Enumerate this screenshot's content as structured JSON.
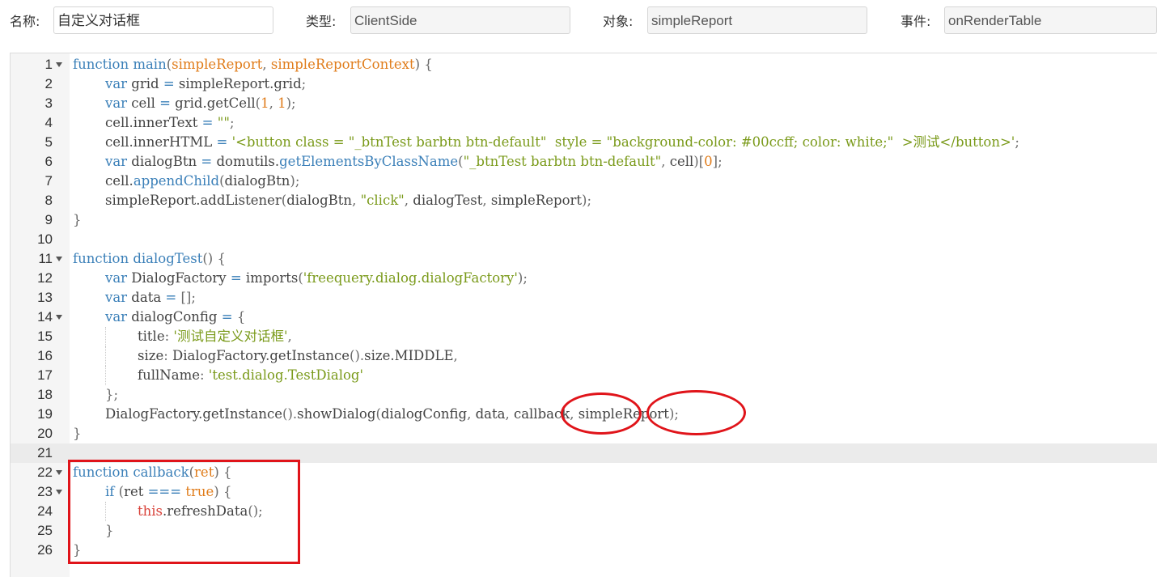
{
  "form": {
    "name_label": "名称:",
    "name_value": "自定义对话框",
    "type_label": "类型:",
    "type_value": "ClientSide",
    "object_label": "对象:",
    "object_value": "simpleReport",
    "event_label": "事件:",
    "event_value": "onRenderTable"
  },
  "editor": {
    "active_line": 21,
    "lines": [
      {
        "n": "1",
        "fold": true,
        "indent": 0,
        "tokens": [
          [
            "kw",
            "function"
          ],
          [
            "pl",
            " "
          ],
          [
            "fn",
            "main"
          ],
          [
            "pu",
            "("
          ],
          [
            "pr",
            "simpleReport"
          ],
          [
            "pu",
            ", "
          ],
          [
            "pr",
            "simpleReportContext"
          ],
          [
            "pu",
            ") {"
          ]
        ]
      },
      {
        "n": "2",
        "fold": false,
        "indent": 1,
        "tokens": [
          [
            "kw",
            "var"
          ],
          [
            "pl",
            " grid "
          ],
          [
            "op",
            "="
          ],
          [
            "pl",
            " simpleReport.grid"
          ],
          [
            "pu",
            ";"
          ]
        ]
      },
      {
        "n": "3",
        "fold": false,
        "indent": 1,
        "tokens": [
          [
            "kw",
            "var"
          ],
          [
            "pl",
            " cell "
          ],
          [
            "op",
            "="
          ],
          [
            "pl",
            " grid.getCell"
          ],
          [
            "pu",
            "("
          ],
          [
            "num",
            "1"
          ],
          [
            "pu",
            ", "
          ],
          [
            "num",
            "1"
          ],
          [
            "pu",
            ");"
          ]
        ]
      },
      {
        "n": "4",
        "fold": false,
        "indent": 1,
        "tokens": [
          [
            "pl",
            "cell.innerText "
          ],
          [
            "op",
            "="
          ],
          [
            "pl",
            " "
          ],
          [
            "str",
            "\"\""
          ],
          [
            "pu",
            ";"
          ]
        ]
      },
      {
        "n": "5",
        "fold": false,
        "indent": 1,
        "tokens": [
          [
            "pl",
            "cell.innerHTML "
          ],
          [
            "op",
            "="
          ],
          [
            "pl",
            " "
          ],
          [
            "str",
            "'<button class = \"_btnTest barbtn btn-default\"  style = \"background-color: #00ccff; color: white;\"  >测试</button>'"
          ],
          [
            "pu",
            ";"
          ]
        ]
      },
      {
        "n": "6",
        "fold": false,
        "indent": 1,
        "tokens": [
          [
            "kw",
            "var"
          ],
          [
            "pl",
            " dialogBtn "
          ],
          [
            "op",
            "="
          ],
          [
            "pl",
            " domutils."
          ],
          [
            "bt",
            "getElementsByClassName"
          ],
          [
            "pu",
            "("
          ],
          [
            "str",
            "\"_btnTest barbtn btn-default\""
          ],
          [
            "pu",
            ", "
          ],
          [
            "pl",
            "cell"
          ],
          [
            "pu",
            ")["
          ],
          [
            "num",
            "0"
          ],
          [
            "pu",
            "];"
          ]
        ]
      },
      {
        "n": "7",
        "fold": false,
        "indent": 1,
        "tokens": [
          [
            "pl",
            "cell."
          ],
          [
            "bt",
            "appendChild"
          ],
          [
            "pu",
            "("
          ],
          [
            "pl",
            "dialogBtn"
          ],
          [
            "pu",
            ");"
          ]
        ]
      },
      {
        "n": "8",
        "fold": false,
        "indent": 1,
        "tokens": [
          [
            "pl",
            "simpleReport.addListener"
          ],
          [
            "pu",
            "("
          ],
          [
            "pl",
            "dialogBtn"
          ],
          [
            "pu",
            ", "
          ],
          [
            "str",
            "\"click\""
          ],
          [
            "pu",
            ", "
          ],
          [
            "pl",
            "dialogTest"
          ],
          [
            "pu",
            ", "
          ],
          [
            "pl",
            "simpleReport"
          ],
          [
            "pu",
            ");"
          ]
        ]
      },
      {
        "n": "9",
        "fold": false,
        "indent": 0,
        "tokens": [
          [
            "pu",
            "}"
          ]
        ]
      },
      {
        "n": "10",
        "fold": false,
        "indent": 0,
        "tokens": []
      },
      {
        "n": "11",
        "fold": true,
        "indent": 0,
        "tokens": [
          [
            "kw",
            "function"
          ],
          [
            "pl",
            " "
          ],
          [
            "fn",
            "dialogTest"
          ],
          [
            "pu",
            "() {"
          ]
        ]
      },
      {
        "n": "12",
        "fold": false,
        "indent": 1,
        "tokens": [
          [
            "kw",
            "var"
          ],
          [
            "pl",
            " DialogFactory "
          ],
          [
            "op",
            "="
          ],
          [
            "pl",
            " imports"
          ],
          [
            "pu",
            "("
          ],
          [
            "str",
            "'freequery.dialog.dialogFactory'"
          ],
          [
            "pu",
            ");"
          ]
        ]
      },
      {
        "n": "13",
        "fold": false,
        "indent": 1,
        "tokens": [
          [
            "kw",
            "var"
          ],
          [
            "pl",
            " data "
          ],
          [
            "op",
            "="
          ],
          [
            "pl",
            " "
          ],
          [
            "pu",
            "[];"
          ]
        ]
      },
      {
        "n": "14",
        "fold": true,
        "indent": 1,
        "tokens": [
          [
            "kw",
            "var"
          ],
          [
            "pl",
            " dialogConfig "
          ],
          [
            "op",
            "="
          ],
          [
            "pl",
            " "
          ],
          [
            "pu",
            "{"
          ]
        ]
      },
      {
        "n": "15",
        "fold": false,
        "indent": 2,
        "tokens": [
          [
            "pl",
            "title"
          ],
          [
            "pu",
            ": "
          ],
          [
            "str",
            "'测试自定义对话框'"
          ],
          [
            "pu",
            ","
          ]
        ]
      },
      {
        "n": "16",
        "fold": false,
        "indent": 2,
        "tokens": [
          [
            "pl",
            "size"
          ],
          [
            "pu",
            ": "
          ],
          [
            "pl",
            "DialogFactory.getInstance"
          ],
          [
            "pu",
            "()."
          ],
          [
            "pl",
            "size.MIDDLE"
          ],
          [
            "pu",
            ","
          ]
        ]
      },
      {
        "n": "17",
        "fold": false,
        "indent": 2,
        "tokens": [
          [
            "pl",
            "fullName"
          ],
          [
            "pu",
            ": "
          ],
          [
            "str",
            "'test.dialog.TestDialog'"
          ]
        ]
      },
      {
        "n": "18",
        "fold": false,
        "indent": 1,
        "tokens": [
          [
            "pu",
            "};"
          ]
        ]
      },
      {
        "n": "19",
        "fold": false,
        "indent": 1,
        "tokens": [
          [
            "pl",
            "DialogFactory.getInstance"
          ],
          [
            "pu",
            "()."
          ],
          [
            "pl",
            "showDialog"
          ],
          [
            "pu",
            "("
          ],
          [
            "pl",
            "dialogConfig"
          ],
          [
            "pu",
            ", "
          ],
          [
            "pl",
            "data"
          ],
          [
            "pu",
            ", "
          ],
          [
            "pl",
            "callback"
          ],
          [
            "pu",
            ", "
          ],
          [
            "pl",
            "simpleReport"
          ],
          [
            "pu",
            ");"
          ]
        ]
      },
      {
        "n": "20",
        "fold": false,
        "indent": 0,
        "tokens": [
          [
            "pu",
            "}"
          ]
        ]
      },
      {
        "n": "21",
        "fold": false,
        "indent": 0,
        "tokens": []
      },
      {
        "n": "22",
        "fold": true,
        "indent": 0,
        "tokens": [
          [
            "kw",
            "function"
          ],
          [
            "pl",
            " "
          ],
          [
            "fn",
            "callback"
          ],
          [
            "pu",
            "("
          ],
          [
            "pr",
            "ret"
          ],
          [
            "pu",
            ") {"
          ]
        ]
      },
      {
        "n": "23",
        "fold": true,
        "indent": 1,
        "tokens": [
          [
            "kw",
            "if"
          ],
          [
            "pl",
            " "
          ],
          [
            "pu",
            "("
          ],
          [
            "pl",
            "ret "
          ],
          [
            "op",
            "==="
          ],
          [
            "pl",
            " "
          ],
          [
            "tl",
            "true"
          ],
          [
            "pu",
            ") {"
          ]
        ]
      },
      {
        "n": "24",
        "fold": false,
        "indent": 2,
        "tokens": [
          [
            "ty",
            "this"
          ],
          [
            "pl",
            ".refreshData"
          ],
          [
            "pu",
            "();"
          ]
        ]
      },
      {
        "n": "25",
        "fold": false,
        "indent": 1,
        "tokens": [
          [
            "pu",
            "}"
          ]
        ]
      },
      {
        "n": "26",
        "fold": false,
        "indent": 0,
        "tokens": [
          [
            "pu",
            "}"
          ]
        ]
      }
    ]
  },
  "annotations": {
    "color": "#e0141a",
    "circled_args": [
      "callback",
      "simpleReport"
    ],
    "boxed_block": "function callback"
  }
}
